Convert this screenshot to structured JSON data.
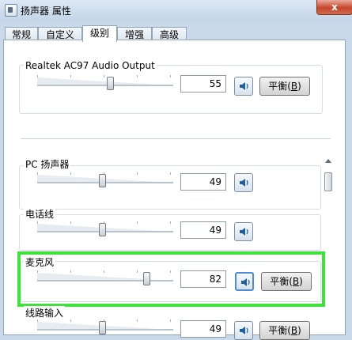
{
  "window": {
    "title": "扬声器 属性",
    "close_glyph": "x"
  },
  "tabs": [
    {
      "label": "常规",
      "active": false
    },
    {
      "label": "自定义",
      "active": false
    },
    {
      "label": "级别",
      "active": true
    },
    {
      "label": "增强",
      "active": false
    },
    {
      "label": "高级",
      "active": false
    }
  ],
  "master": {
    "label": "Realtek AC97 Audio Output",
    "value": "55",
    "level": 55,
    "balance_label": "平衡(",
    "balance_key": "B",
    "balance_close": ")"
  },
  "devices": [
    {
      "label": "PC 扬声器",
      "value": "49",
      "level": 49
    },
    {
      "label": "电话线",
      "value": "49",
      "level": 49
    },
    {
      "label": "麦克风",
      "value": "82",
      "level": 82,
      "balance_label": "平衡(",
      "balance_key": "B",
      "balance_close": ")"
    },
    {
      "label": "线路输入",
      "value": "49",
      "level": 49,
      "balance_label": "平衡(",
      "balance_key": "B",
      "balance_close": ")"
    }
  ],
  "colors": {
    "highlight": "#3ee23a",
    "accent": "#4e8bd1"
  },
  "icons": {
    "speaker": "speaker-icon",
    "scroll_up": "scroll-up-arrow-icon"
  }
}
